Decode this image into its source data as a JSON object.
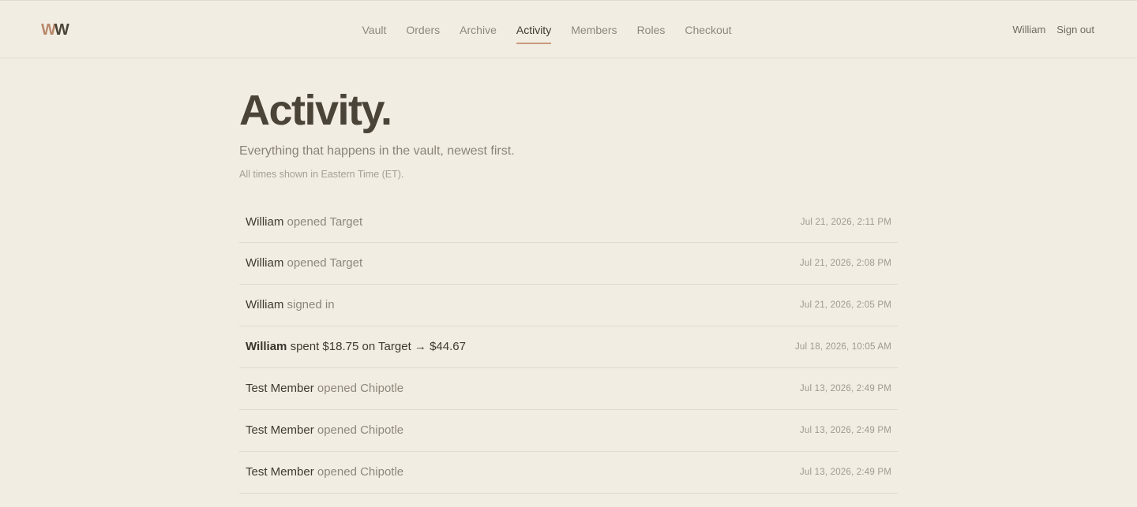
{
  "header": {
    "logo": {
      "first": "W",
      "second": "W"
    },
    "nav": [
      {
        "label": "Vault",
        "active": false
      },
      {
        "label": "Orders",
        "active": false
      },
      {
        "label": "Archive",
        "active": false
      },
      {
        "label": "Activity",
        "active": true
      },
      {
        "label": "Members",
        "active": false
      },
      {
        "label": "Roles",
        "active": false
      },
      {
        "label": "Checkout",
        "active": false
      }
    ],
    "user_name": "William",
    "sign_out_label": "Sign out"
  },
  "page": {
    "title": "Activity.",
    "subtitle": "Everything that happens in the vault, newest first.",
    "timezone_note": "All times shown in Eastern Time (ET)."
  },
  "activity": [
    {
      "actor": "William",
      "action": "opened Target",
      "time": "Jul 21, 2026, 2:11 PM",
      "highlight": false
    },
    {
      "actor": "William",
      "action": "opened Target",
      "time": "Jul 21, 2026, 2:08 PM",
      "highlight": false
    },
    {
      "actor": "William",
      "action": "signed in",
      "time": "Jul 21, 2026, 2:05 PM",
      "highlight": false
    },
    {
      "actor": "William",
      "action": "spent $18.75 on Target → $44.67",
      "time": "Jul 18, 2026, 10:05 AM",
      "highlight": true
    },
    {
      "actor": "Test Member",
      "action": "opened Chipotle",
      "time": "Jul 13, 2026, 2:49 PM",
      "highlight": false
    },
    {
      "actor": "Test Member",
      "action": "opened Chipotle",
      "time": "Jul 13, 2026, 2:49 PM",
      "highlight": false
    },
    {
      "actor": "Test Member",
      "action": "opened Chipotle",
      "time": "Jul 13, 2026, 2:49 PM",
      "highlight": false
    }
  ],
  "colors": {
    "background": "#f2ede3",
    "accent": "#c89a7c",
    "logo_accent": "#b8886a",
    "text_primary": "#4a4438",
    "text_muted": "#8d877b"
  }
}
